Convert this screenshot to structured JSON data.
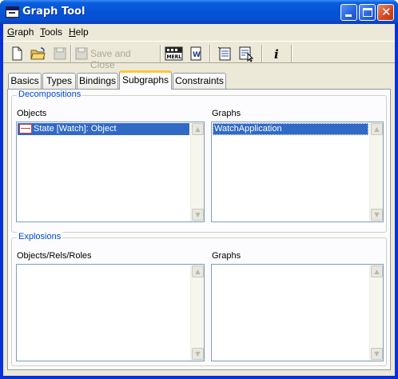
{
  "window": {
    "title": "Graph Tool"
  },
  "menu": [
    {
      "label": "Graph",
      "mnemonic": "G",
      "rest": "raph"
    },
    {
      "label": "Tools",
      "mnemonic": "T",
      "rest": "ools"
    },
    {
      "label": "Help",
      "mnemonic": "H",
      "rest": "elp"
    }
  ],
  "toolbar": {
    "save_close_label": "Save and Close",
    "icons": [
      "new-icon",
      "open-icon",
      "save-icon",
      "save-close-icon",
      "merl-icon",
      "word-report-icon",
      "list-icon",
      "select-list-icon",
      "info-icon"
    ]
  },
  "tabs": [
    {
      "label": "Basics"
    },
    {
      "label": "Types"
    },
    {
      "label": "Bindings"
    },
    {
      "label": "Subgraphs",
      "active": true
    },
    {
      "label": "Constraints"
    }
  ],
  "decompositions": {
    "title": "Decompositions",
    "objects_label": "Objects",
    "graphs_label": "Graphs",
    "objects": [
      "State [Watch]: Object"
    ],
    "graphs": [
      "WatchApplication"
    ]
  },
  "explosions": {
    "title": "Explosions",
    "objects_label": "Objects/Rels/Roles",
    "graphs_label": "Graphs",
    "objects": [],
    "graphs": []
  },
  "colors": {
    "titlebar": "#0553D6",
    "selection": "#316AC5",
    "group_title": "#0046D5",
    "tab_highlight": "#FFC83C"
  }
}
